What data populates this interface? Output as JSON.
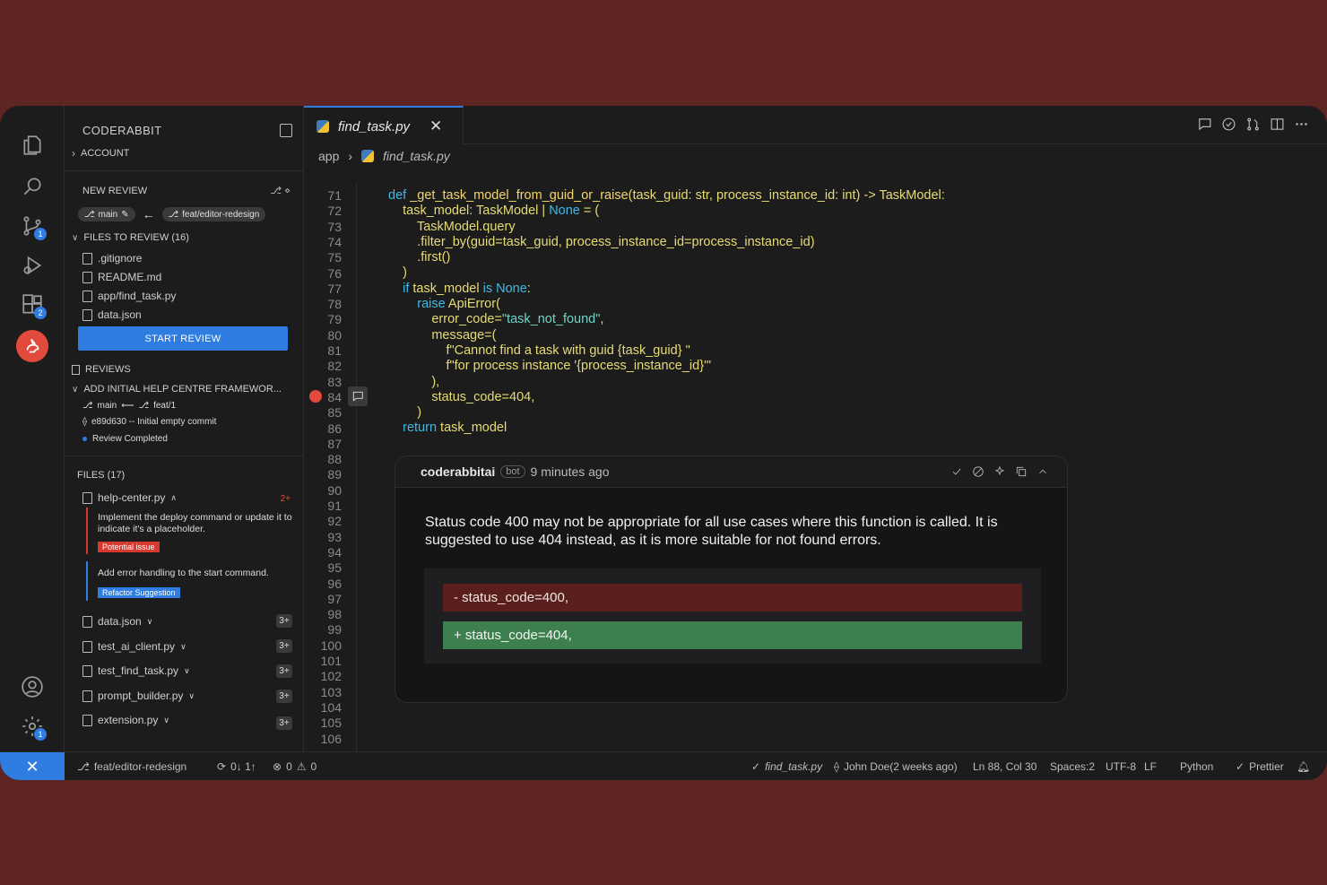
{
  "activity": {
    "scm_badge": "1",
    "ext_badge": "2",
    "settings_badge": "1"
  },
  "sidebar": {
    "title": "CODERABBIT",
    "account": "ACCOUNT",
    "new_review": "NEW REVIEW",
    "base_branch": "main",
    "head_branch": "feat/editor-redesign",
    "files_to_review": "FILES TO REVIEW (16)",
    "files": [
      ".gitignore",
      "README.md",
      "app/find_task.py",
      "data.json"
    ],
    "start_review": "START REVIEW",
    "reviews": "REVIEWS",
    "review_title": "ADD INITIAL HELP CENTRE FRAMEWOR...",
    "review_base": "main",
    "review_head": "feat/1",
    "review_commit": "e89d630 -- Initial empty commit",
    "review_status": "Review Completed",
    "files17": "FILES (17)",
    "rfiles": [
      {
        "name": "help-center.py",
        "count": "2+"
      },
      {
        "name": "data.json",
        "count": "3+"
      },
      {
        "name": "test_ai_client.py",
        "count": "3+"
      },
      {
        "name": "test_find_task.py",
        "count": "3+"
      },
      {
        "name": "prompt_builder.py",
        "count": "3+"
      },
      {
        "name": "extension.py",
        "count": "3+"
      }
    ],
    "issue1": "Implement the deploy command or update it to indicate it's a placeholder.",
    "issue1_tag": "Potential issue",
    "issue2": "Add error handling to the start command.",
    "issue2_tag": "Refactor Suggestion"
  },
  "editor": {
    "tab": "find_task.py",
    "crumb_dir": "app",
    "crumb_file": "find_task.py",
    "line_start": 71,
    "line_end": 106,
    "comment": {
      "author": "coderabbitai",
      "bot": "bot",
      "time": "9 minutes ago",
      "body": "Status code 400 may not be appropriate for all use cases where this function is called. It is suggested to use 404 instead, as it is more suitable for not found errors.",
      "del": "- status_code=400,",
      "add": "+ status_code=404,"
    }
  },
  "status": {
    "branch": "feat/editor-redesign",
    "sync": "0↓ 1↑",
    "errors": "0",
    "warnings": "0",
    "file": "find_task.py",
    "blame": "John Doe(2 weeks ago)",
    "pos": "Ln 88, Col 30",
    "spaces": "Spaces:2",
    "enc": "UTF-8",
    "eol": "LF",
    "lang": "Python",
    "fmt": "Prettier"
  }
}
